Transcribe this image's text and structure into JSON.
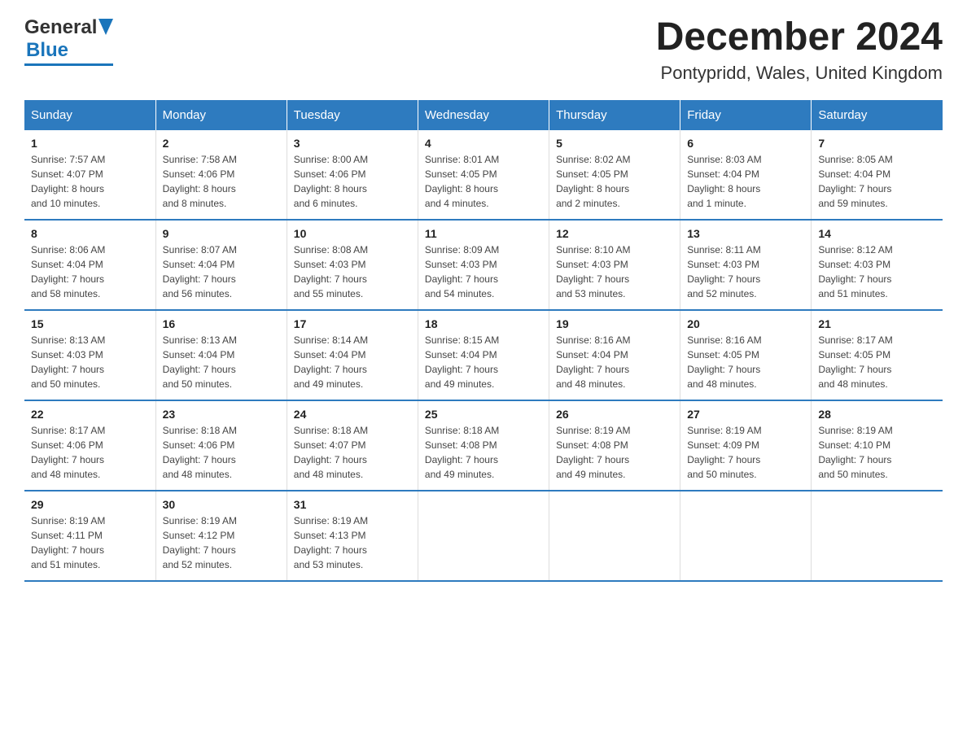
{
  "header": {
    "title": "December 2024",
    "subtitle": "Pontypridd, Wales, United Kingdom",
    "logo_general": "General",
    "logo_blue": "Blue"
  },
  "days_of_week": [
    "Sunday",
    "Monday",
    "Tuesday",
    "Wednesday",
    "Thursday",
    "Friday",
    "Saturday"
  ],
  "weeks": [
    [
      {
        "day": "1",
        "sunrise": "7:57 AM",
        "sunset": "4:07 PM",
        "daylight": "8 hours and 10 minutes."
      },
      {
        "day": "2",
        "sunrise": "7:58 AM",
        "sunset": "4:06 PM",
        "daylight": "8 hours and 8 minutes."
      },
      {
        "day": "3",
        "sunrise": "8:00 AM",
        "sunset": "4:06 PM",
        "daylight": "8 hours and 6 minutes."
      },
      {
        "day": "4",
        "sunrise": "8:01 AM",
        "sunset": "4:05 PM",
        "daylight": "8 hours and 4 minutes."
      },
      {
        "day": "5",
        "sunrise": "8:02 AM",
        "sunset": "4:05 PM",
        "daylight": "8 hours and 2 minutes."
      },
      {
        "day": "6",
        "sunrise": "8:03 AM",
        "sunset": "4:04 PM",
        "daylight": "8 hours and 1 minute."
      },
      {
        "day": "7",
        "sunrise": "8:05 AM",
        "sunset": "4:04 PM",
        "daylight": "7 hours and 59 minutes."
      }
    ],
    [
      {
        "day": "8",
        "sunrise": "8:06 AM",
        "sunset": "4:04 PM",
        "daylight": "7 hours and 58 minutes."
      },
      {
        "day": "9",
        "sunrise": "8:07 AM",
        "sunset": "4:04 PM",
        "daylight": "7 hours and 56 minutes."
      },
      {
        "day": "10",
        "sunrise": "8:08 AM",
        "sunset": "4:03 PM",
        "daylight": "7 hours and 55 minutes."
      },
      {
        "day": "11",
        "sunrise": "8:09 AM",
        "sunset": "4:03 PM",
        "daylight": "7 hours and 54 minutes."
      },
      {
        "day": "12",
        "sunrise": "8:10 AM",
        "sunset": "4:03 PM",
        "daylight": "7 hours and 53 minutes."
      },
      {
        "day": "13",
        "sunrise": "8:11 AM",
        "sunset": "4:03 PM",
        "daylight": "7 hours and 52 minutes."
      },
      {
        "day": "14",
        "sunrise": "8:12 AM",
        "sunset": "4:03 PM",
        "daylight": "7 hours and 51 minutes."
      }
    ],
    [
      {
        "day": "15",
        "sunrise": "8:13 AM",
        "sunset": "4:03 PM",
        "daylight": "7 hours and 50 minutes."
      },
      {
        "day": "16",
        "sunrise": "8:13 AM",
        "sunset": "4:04 PM",
        "daylight": "7 hours and 50 minutes."
      },
      {
        "day": "17",
        "sunrise": "8:14 AM",
        "sunset": "4:04 PM",
        "daylight": "7 hours and 49 minutes."
      },
      {
        "day": "18",
        "sunrise": "8:15 AM",
        "sunset": "4:04 PM",
        "daylight": "7 hours and 49 minutes."
      },
      {
        "day": "19",
        "sunrise": "8:16 AM",
        "sunset": "4:04 PM",
        "daylight": "7 hours and 48 minutes."
      },
      {
        "day": "20",
        "sunrise": "8:16 AM",
        "sunset": "4:05 PM",
        "daylight": "7 hours and 48 minutes."
      },
      {
        "day": "21",
        "sunrise": "8:17 AM",
        "sunset": "4:05 PM",
        "daylight": "7 hours and 48 minutes."
      }
    ],
    [
      {
        "day": "22",
        "sunrise": "8:17 AM",
        "sunset": "4:06 PM",
        "daylight": "7 hours and 48 minutes."
      },
      {
        "day": "23",
        "sunrise": "8:18 AM",
        "sunset": "4:06 PM",
        "daylight": "7 hours and 48 minutes."
      },
      {
        "day": "24",
        "sunrise": "8:18 AM",
        "sunset": "4:07 PM",
        "daylight": "7 hours and 48 minutes."
      },
      {
        "day": "25",
        "sunrise": "8:18 AM",
        "sunset": "4:08 PM",
        "daylight": "7 hours and 49 minutes."
      },
      {
        "day": "26",
        "sunrise": "8:19 AM",
        "sunset": "4:08 PM",
        "daylight": "7 hours and 49 minutes."
      },
      {
        "day": "27",
        "sunrise": "8:19 AM",
        "sunset": "4:09 PM",
        "daylight": "7 hours and 50 minutes."
      },
      {
        "day": "28",
        "sunrise": "8:19 AM",
        "sunset": "4:10 PM",
        "daylight": "7 hours and 50 minutes."
      }
    ],
    [
      {
        "day": "29",
        "sunrise": "8:19 AM",
        "sunset": "4:11 PM",
        "daylight": "7 hours and 51 minutes."
      },
      {
        "day": "30",
        "sunrise": "8:19 AM",
        "sunset": "4:12 PM",
        "daylight": "7 hours and 52 minutes."
      },
      {
        "day": "31",
        "sunrise": "8:19 AM",
        "sunset": "4:13 PM",
        "daylight": "7 hours and 53 minutes."
      },
      null,
      null,
      null,
      null
    ]
  ],
  "labels": {
    "sunrise": "Sunrise:",
    "sunset": "Sunset:",
    "daylight": "Daylight:"
  }
}
